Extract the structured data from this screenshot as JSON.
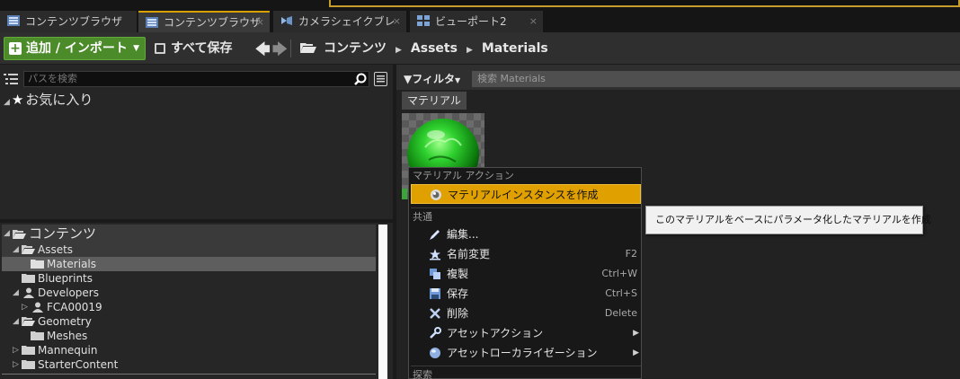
{
  "tabs": [
    {
      "label": "コンテンツブラウザ",
      "icon": "content-browser-icon",
      "active": false
    },
    {
      "label": "コンテンツブラウザ",
      "icon": "content-browser-icon",
      "active": true,
      "close": "×"
    },
    {
      "label": "カメラシェイクブレ",
      "icon": "camera-shake-icon",
      "active": false,
      "close": "×"
    },
    {
      "label": "ビューポート2",
      "icon": "viewport-icon",
      "active": false,
      "close": "×"
    }
  ],
  "toolbar": {
    "add_import_label": "追加 / インポート",
    "save_all_label": "すべて保存",
    "nav_back": "🡄",
    "nav_forward": "🡆",
    "breadcrumb": [
      "コンテンツ",
      "Assets",
      "Materials"
    ]
  },
  "left_panel": {
    "path_search_placeholder": "パスを検索",
    "favorites_label": "お気に入り",
    "tree": [
      {
        "label": "コンテンツ",
        "level": 0,
        "icon": "folder-icon",
        "expanded": true
      },
      {
        "label": "Assets",
        "level": 1,
        "icon": "folder-icon",
        "expanded": true
      },
      {
        "label": "Materials",
        "level": 2,
        "icon": "folder-icon",
        "selected": true
      },
      {
        "label": "Blueprints",
        "level": 1,
        "icon": "folder-icon"
      },
      {
        "label": "Developers",
        "level": 1,
        "icon": "user-icon",
        "expanded": true
      },
      {
        "label": "FCA00019",
        "level": 2,
        "icon": "user-icon",
        "collapsed": true
      },
      {
        "label": "Geometry",
        "level": 1,
        "icon": "folder-icon",
        "expanded": true
      },
      {
        "label": "Meshes",
        "level": 2,
        "icon": "folder-icon"
      },
      {
        "label": "Mannequin",
        "level": 1,
        "icon": "folder-icon",
        "collapsed": true
      },
      {
        "label": "StarterContent",
        "level": 1,
        "icon": "folder-icon",
        "collapsed": true
      }
    ]
  },
  "right_panel": {
    "filter_label": "フィルタ",
    "asset_search_placeholder": "検索 Materials",
    "category_label": "マテリアル"
  },
  "context_menu": {
    "section_material": "マテリアル アクション",
    "create_instance_label": "マテリアルインスタンスを作成",
    "section_common": "共通",
    "items": [
      {
        "label": "編集...",
        "shortcut": "",
        "icon": "edit-icon"
      },
      {
        "label": "名前変更",
        "shortcut": "F2",
        "icon": "rename-icon"
      },
      {
        "label": "複製",
        "shortcut": "Ctrl+W",
        "icon": "duplicate-icon"
      },
      {
        "label": "保存",
        "shortcut": "Ctrl+S",
        "icon": "save-icon"
      },
      {
        "label": "削除",
        "shortcut": "Delete",
        "icon": "delete-icon"
      },
      {
        "label": "アセットアクション",
        "shortcut": "",
        "icon": "wrench-icon",
        "submenu": true
      },
      {
        "label": "アセットローカライゼーション",
        "shortcut": "",
        "icon": "globe-icon",
        "submenu": true
      }
    ],
    "section_explore": "探索"
  },
  "tooltip": "このマテリアルをベースにパラメータ化したマテリアルを作成",
  "colors": {
    "accent": "#e0a100",
    "add_button": "#4c8b2a",
    "material_preview": "#2fd12f"
  }
}
